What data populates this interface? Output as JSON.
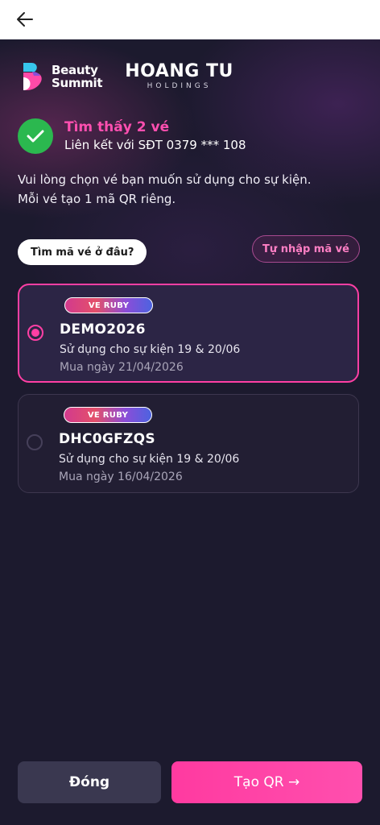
{
  "header": {
    "back_icon": "arrow-left-icon"
  },
  "logos": {
    "beauty_summit_line1": "Beauty",
    "beauty_summit_line2": "Summit",
    "hoang_tu_main": "HOANG TU",
    "hoang_tu_sub": "HOLDINGS"
  },
  "status": {
    "icon": "check-icon",
    "title": "Tìm thấy 2 vé",
    "subtitle": "Liên kết với SĐT 0379 *** 108"
  },
  "intro": {
    "line1": "Vui lòng chọn vé bạn muốn sử dụng cho sự kiện.",
    "line2": "Mỗi vé tạo 1 mã QR riêng."
  },
  "actions": {
    "where_label": "Tìm mã vé ở đâu?",
    "manual_label": "Tự nhập mã vé"
  },
  "tickets": [
    {
      "badge": "VE RUBY",
      "code": "DEMO2026",
      "usage": "Sử dụng cho sự kiện 19 & 20/06",
      "purchased": "Mua ngày 21/04/2026",
      "selected": true
    },
    {
      "badge": "VE RUBY",
      "code": "DHC0GFZQS",
      "usage": "Sử dụng cho sự kiện 19 & 20/06",
      "purchased": "Mua ngày 16/04/2026",
      "selected": false
    }
  ],
  "footer": {
    "close_label": "Đóng",
    "create_qr_label": "Tạo QR →"
  },
  "colors": {
    "background": "#1c1a2e",
    "accent_pink": "#ff3fa4",
    "success_green": "#2bb84f"
  }
}
